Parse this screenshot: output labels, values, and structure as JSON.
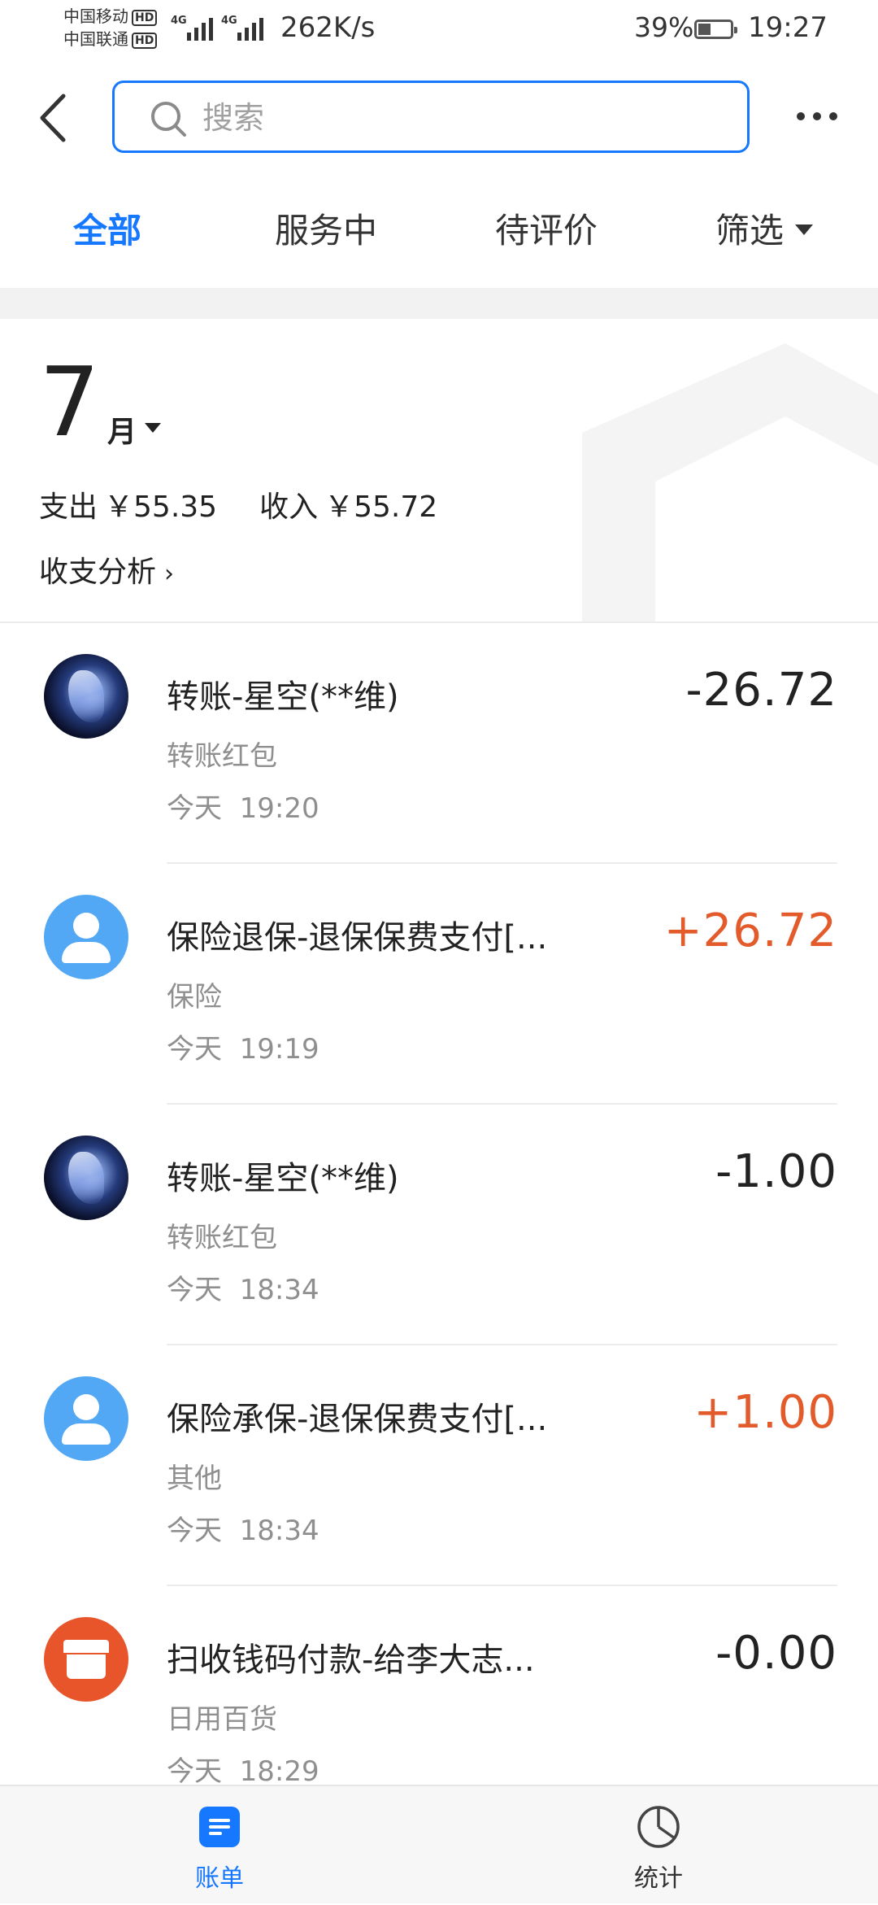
{
  "status": {
    "carrier1": "中国移动",
    "carrier2": "中国联通",
    "hd": "HD",
    "network": "4G",
    "speed": "262K/s",
    "battery": "39%",
    "battery_level": 0.39,
    "time": "19:27"
  },
  "search": {
    "placeholder": "搜索"
  },
  "tabs": [
    {
      "label": "全部"
    },
    {
      "label": "服务中"
    },
    {
      "label": "待评价"
    },
    {
      "label": "筛选"
    }
  ],
  "summary": {
    "month": "7",
    "month_unit": "月",
    "expense_label": "支出",
    "expense": "￥55.35",
    "income_label": "收入",
    "income": "￥55.72",
    "analysis": "收支分析",
    "analysis_chevron": "›"
  },
  "transactions": [
    {
      "title": "转账-星空(**维)",
      "category": "转账红包",
      "time": "今天  19:20",
      "amount": "-26.72",
      "avatar": "starry-avatar"
    },
    {
      "title": "保险退保-退保保费支付[...",
      "category": "保险",
      "time": "今天  19:19",
      "amount": "+26.72",
      "avatar": "user-icon"
    },
    {
      "title": "转账-星空(**维)",
      "category": "转账红包",
      "time": "今天  18:34",
      "amount": "-1.00",
      "avatar": "starry-avatar"
    },
    {
      "title": "保险承保-退保保费支付[...",
      "category": "其他",
      "time": "今天  18:34",
      "amount": "+1.00",
      "avatar": "user-icon"
    },
    {
      "title": "扫收钱码付款-给李大志...",
      "category": "日用百货",
      "time": "今天  18:29",
      "amount": "-0.00",
      "avatar": "shop-icon"
    }
  ],
  "nav": {
    "bill": "账单",
    "stats": "统计"
  },
  "colors": {
    "accent": "#1677ff",
    "income": "#e35b2a",
    "user_avatar": "#52a8f5",
    "shop_avatar": "#e8552a"
  }
}
